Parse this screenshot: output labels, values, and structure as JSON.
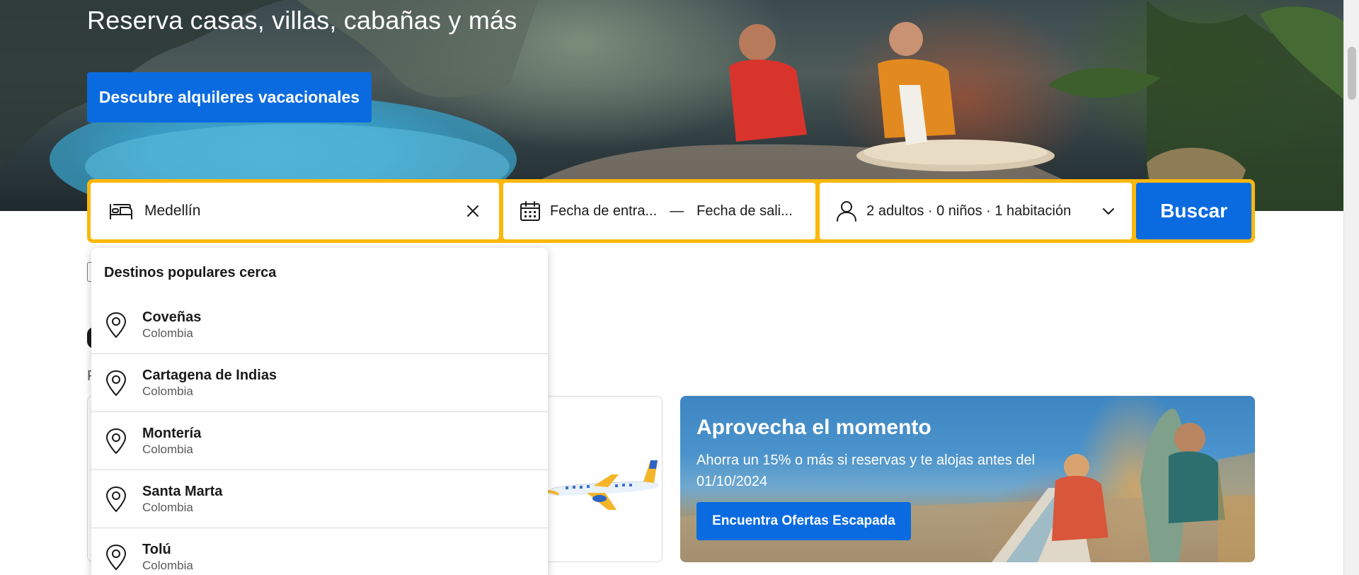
{
  "hero": {
    "title": "Reserva casas, villas, cabañas y más",
    "cta_label": "Descubre alquileres vacacionales"
  },
  "search": {
    "destination_value": "Medellín",
    "checkin_placeholder": "Fecha de entra...",
    "separator": "—",
    "checkout_placeholder": "Fecha de sali...",
    "guests_summary": "2 adultos · 0 niños · 1 habitación",
    "submit_label": "Buscar"
  },
  "dropdown": {
    "title": "Destinos populares cerca",
    "items": [
      {
        "name": "Coveñas",
        "country": "Colombia"
      },
      {
        "name": "Cartagena de Indias",
        "country": "Colombia"
      },
      {
        "name": "Montería",
        "country": "Colombia"
      },
      {
        "name": "Santa Marta",
        "country": "Colombia"
      },
      {
        "name": "Tolú",
        "country": "Colombia"
      }
    ]
  },
  "background": {
    "subtitle_fragment": "P"
  },
  "promo": {
    "title": "Aprovecha el momento",
    "text": "Ahorra un 15% o más si reservas y te alojas antes del 01/10/2024",
    "cta_label": "Encuentra Ofertas Escapada"
  },
  "colors": {
    "brand_blue": "#0a6be0",
    "search_border": "#fbb80c"
  },
  "icons": {
    "destination": "bed-icon",
    "clear": "close-icon",
    "dates": "calendar-icon",
    "guests": "person-icon",
    "expand": "chevron-down-icon",
    "location": "map-pin-icon"
  }
}
